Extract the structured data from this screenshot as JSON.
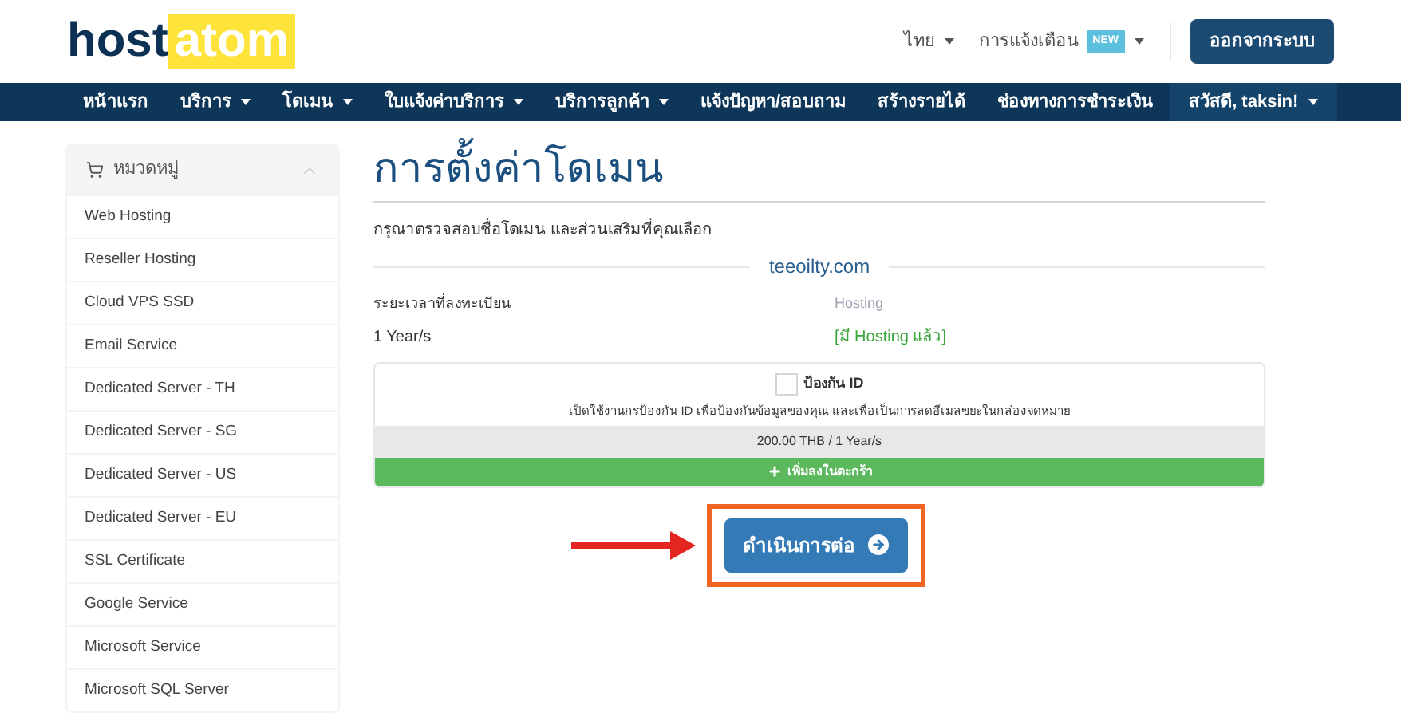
{
  "logo": {
    "part_1": "host",
    "part_2": "atom"
  },
  "top_links": [
    {
      "label": "ไทย"
    },
    {
      "label": "การแจ้งเตือน",
      "badge": "NEW"
    }
  ],
  "logout_button": "ออกจากระบบ",
  "nav": {
    "items": [
      {
        "label": "หน้าแรก",
        "has_menu": false
      },
      {
        "label": "บริการ",
        "has_menu": true
      },
      {
        "label": "โดเมน",
        "has_menu": true
      },
      {
        "label": "ใบแจ้งค่าบริการ",
        "has_menu": true
      },
      {
        "label": "บริการลูกค้า",
        "has_menu": true
      },
      {
        "label": "แจ้งปัญหา/สอบถาม",
        "has_menu": false
      },
      {
        "label": "สร้างรายได้",
        "has_menu": false
      },
      {
        "label": "ช่องทางการชำระเงิน",
        "has_menu": false
      }
    ],
    "user": "สวัสดี, taksin!"
  },
  "sidebar": {
    "title": "หมวดหมู่",
    "items": [
      "Web Hosting",
      "Reseller Hosting",
      "Cloud VPS SSD",
      "Email Service",
      "Dedicated Server - TH",
      "Dedicated Server - SG",
      "Dedicated Server - US",
      "Dedicated Server - EU",
      "SSL Certificate",
      "Google Service",
      "Microsoft Service",
      "Microsoft SQL Server"
    ]
  },
  "page": {
    "title": "การตั้งค่าโดเมน",
    "subtitle": "กรุณาตรวจสอบชื่อโดเมน และส่วนเสริมที่คุณเลือก",
    "domain": "teeoilty.com",
    "period_label": "ระยะเวลาที่ลงทะเบียน",
    "period_value": "1 Year/s",
    "hosting_label": "Hosting",
    "hosting_value": "[มี Hosting แล้ว]",
    "addon": {
      "label": "ป้องกัน ID",
      "checked": false,
      "description": "เปิดใช้งานกรป้องกัน ID เพื่อป้องกันข้อมูลของคุณ และเพื่อเป็นการลดอีเมลขยะในกล่องจดหมาย",
      "price": "200.00 THB / 1 Year/s",
      "add_button": "เพิ่มลงในตะกร้า"
    },
    "continue_button": "ดำเนินการต่อ"
  }
}
